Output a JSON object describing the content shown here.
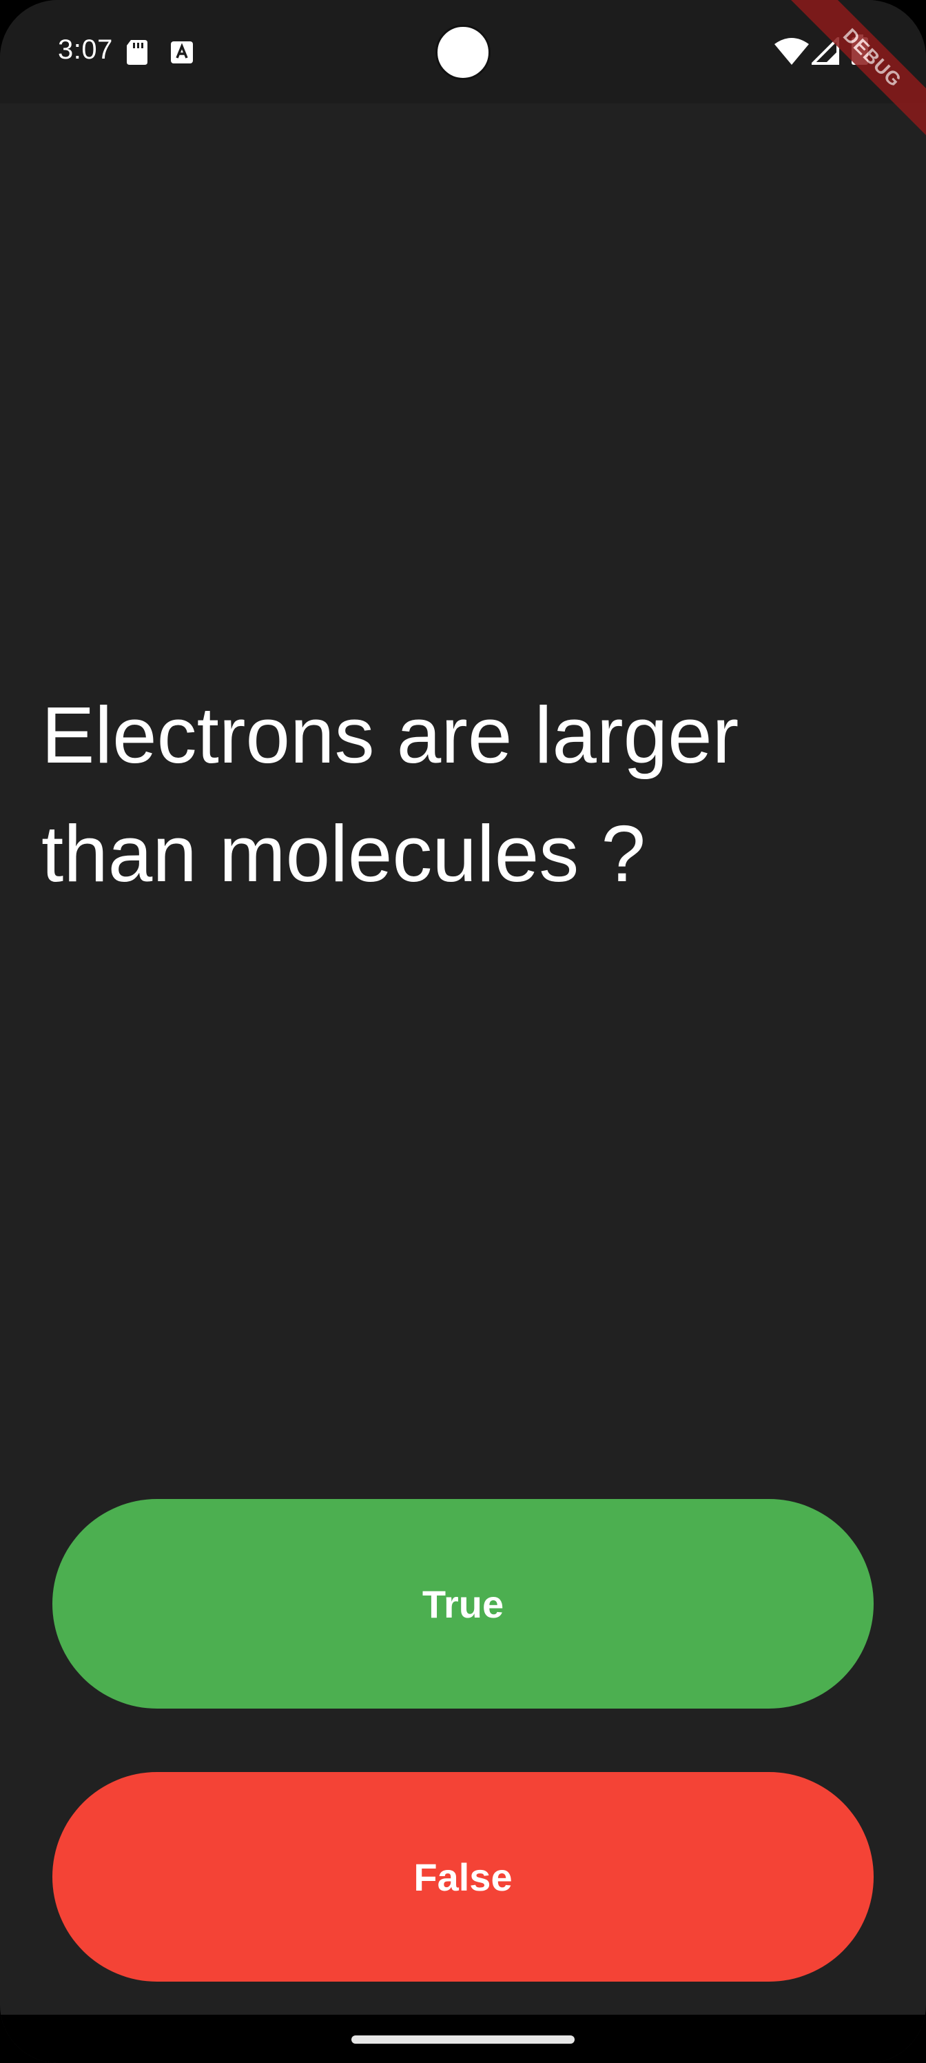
{
  "status_bar": {
    "time": "3:07",
    "icons": [
      "sd-card-icon",
      "a-notification-icon",
      "wifi-icon",
      "cellular-signal-icon",
      "battery-icon"
    ]
  },
  "debug_banner": {
    "label": "DEBUG"
  },
  "quiz": {
    "question": "Electrons are larger than molecules ?",
    "true_label": "True",
    "false_label": "False"
  },
  "colors": {
    "background": "#212121",
    "true_button": "#4caf50",
    "false_button": "#f44336",
    "debug_banner": "#8b1a1a"
  }
}
